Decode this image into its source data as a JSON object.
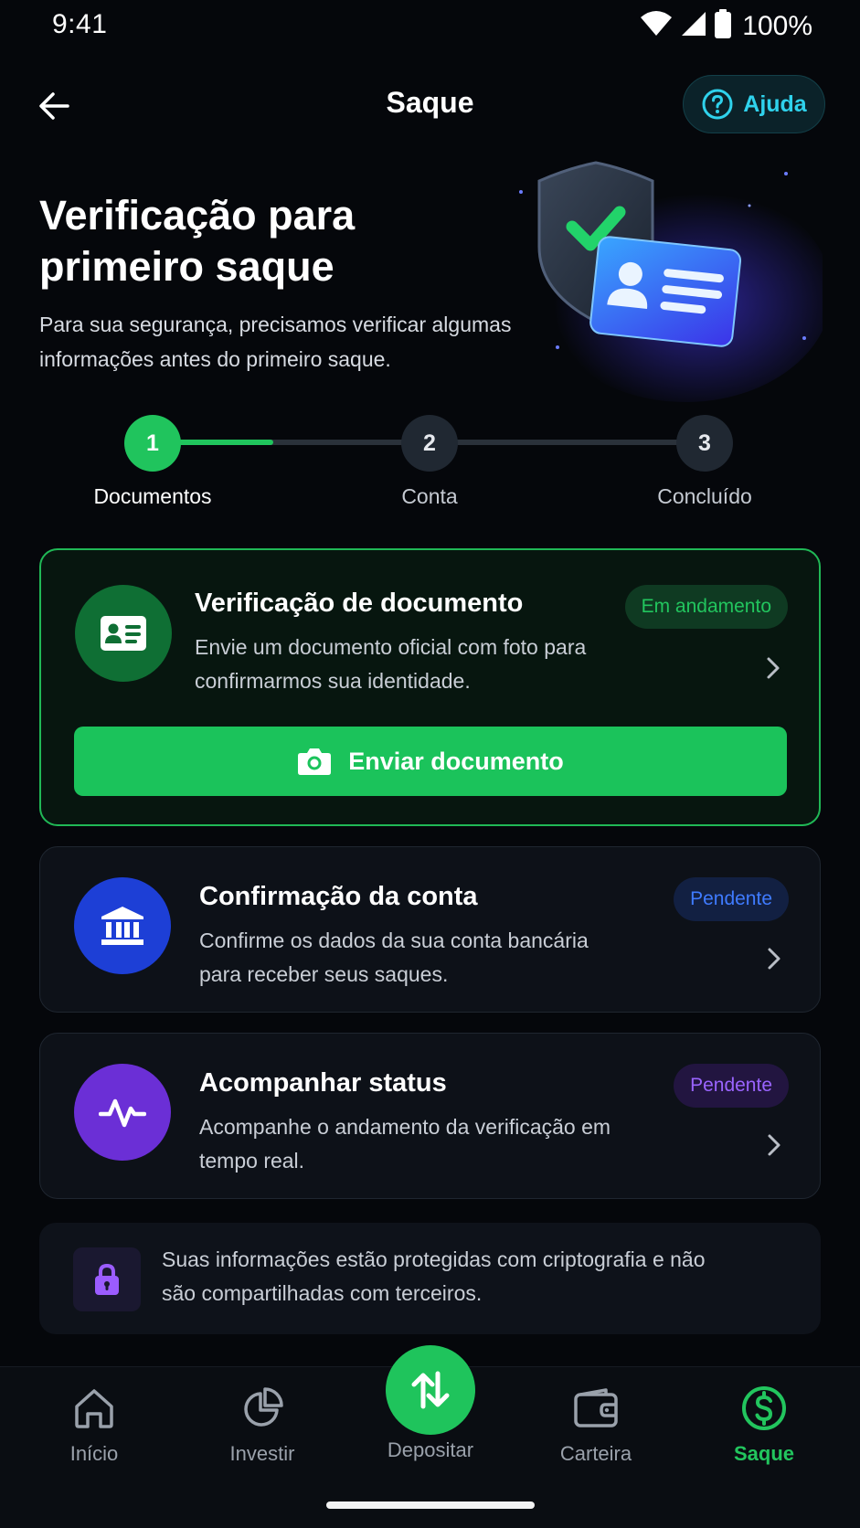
{
  "status_bar": {
    "time": "9:41",
    "battery": "100%"
  },
  "header": {
    "title": "Saque",
    "help_label": "Ajuda"
  },
  "hero": {
    "title": "Verificação para primeiro saque",
    "subtitle": "Para sua segurança, precisamos verificar algumas informações antes do primeiro saque."
  },
  "stepper": {
    "steps": [
      {
        "number": "1",
        "label": "Documentos"
      },
      {
        "number": "2",
        "label": "Conta"
      },
      {
        "number": "3",
        "label": "Concluído"
      }
    ],
    "progress": 0.22
  },
  "cards": [
    {
      "title": "Verificação de documento",
      "description": "Envie um documento oficial com foto para confirmarmos sua identidade.",
      "badge": "Em andamento",
      "button_label": "Enviar documento"
    },
    {
      "title": "Confirmação da conta",
      "description": "Confirme os dados da sua conta bancária para receber seus saques.",
      "badge": "Pendente"
    },
    {
      "title": "Acompanhar status",
      "description": "Acompanhe o andamento da verificação em tempo real.",
      "badge": "Pendente"
    }
  ],
  "info": {
    "text": "Suas informações estão protegidas com criptografia e não são compartilhadas com terceiros."
  },
  "bottom_nav": {
    "items": [
      {
        "label": "Início",
        "icon": "home-icon"
      },
      {
        "label": "Investir",
        "icon": "pie-chart-icon"
      },
      {
        "label": "Depositar",
        "icon": "transfer-arrows-icon"
      },
      {
        "label": "Carteira",
        "icon": "wallet-icon"
      },
      {
        "label": "Saque",
        "icon": "dollar-circle-icon"
      }
    ],
    "active": "Saque"
  },
  "colors": {
    "accent_green": "#22c55e",
    "help_cyan": "#2fd2ec",
    "bank_blue": "#1d3fd6",
    "status_purple": "#6b2fd6",
    "background": "#05070b"
  }
}
